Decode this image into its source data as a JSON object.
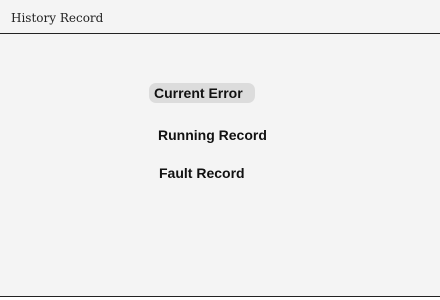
{
  "header": {
    "title": "History Record"
  },
  "menu": {
    "items": [
      {
        "label": "Current Error",
        "selected": true
      },
      {
        "label": "Running Record",
        "selected": false
      },
      {
        "label": "Fault Record",
        "selected": false
      }
    ]
  },
  "colors": {
    "background": "#f4f4f4",
    "selection_highlight": "#dcdcdc",
    "text": "#111111",
    "rule": "#222222"
  }
}
